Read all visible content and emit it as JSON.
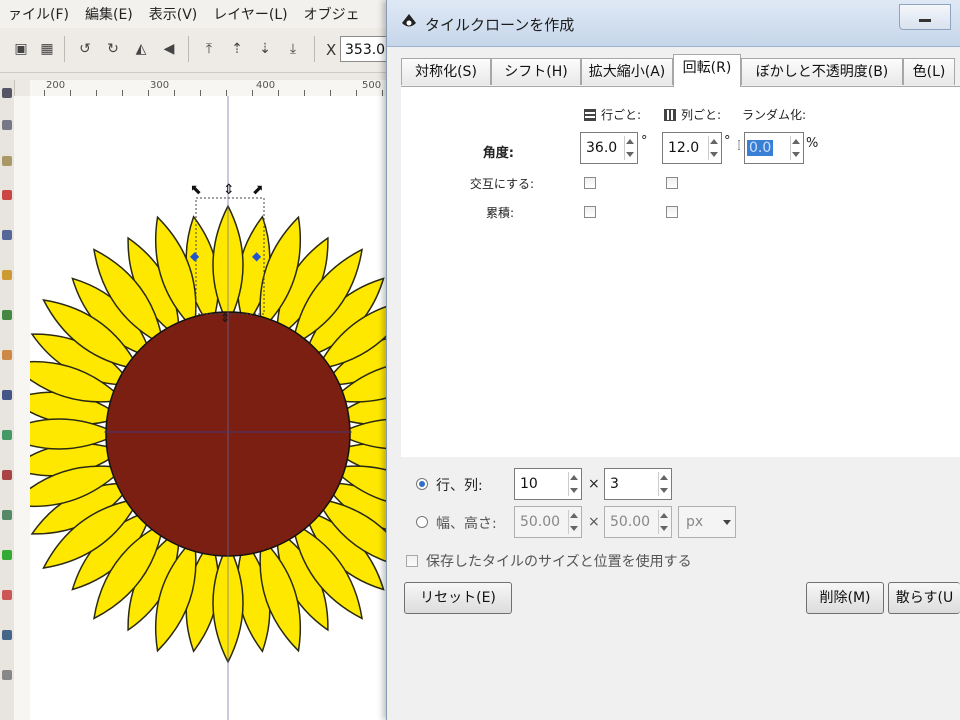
{
  "inkscape": {
    "menu": [
      "ァイル(F)",
      "編集(E)",
      "表示(V)",
      "レイヤー(L)",
      "オブジェ"
    ],
    "toolbar": {
      "x_label": "X",
      "x_value": "353.00"
    },
    "ruler_top": [
      "200",
      "300",
      "400",
      "500"
    ]
  },
  "dialog": {
    "title": "タイルクローンを作成",
    "tabs": [
      "対称化(S)",
      "シフト(H)",
      "拡大縮小(A)",
      "回転(R)",
      "ぼかしと不透明度(B)",
      "色(L)"
    ],
    "active_tab": "回転(R)",
    "rotation": {
      "header_per_row": "行ごと:",
      "header_per_column": "列ごと:",
      "header_random": "ランダム化:",
      "angle_label": "角度:",
      "angle_per_row": "36.0",
      "angle_per_row_unit": "°",
      "angle_per_column": "12.0",
      "angle_per_column_unit": "°",
      "angle_random": "0.0",
      "angle_random_unit": "%",
      "alternate_label": "交互にする:",
      "cumulate_label": "累積:"
    },
    "grid": {
      "rows_cols_label": "行、列:",
      "rows": "10",
      "times": "×",
      "cols": "3",
      "width_height_label": "幅、高さ:",
      "width": "50.00",
      "height": "50.00",
      "unit": "px",
      "use_saved_label": "保存したタイルのサイズと位置を使用する"
    },
    "buttons": {
      "reset": "リセット(E)",
      "delete": "削除(M)",
      "scatter": "散らす(U"
    }
  },
  "colors": {
    "petal": "#ffe800",
    "petal_outline": "#2a2a10",
    "center": "#7a1f12",
    "selection_accent": "#2255cc",
    "titlebar": "#d2e0f0"
  }
}
